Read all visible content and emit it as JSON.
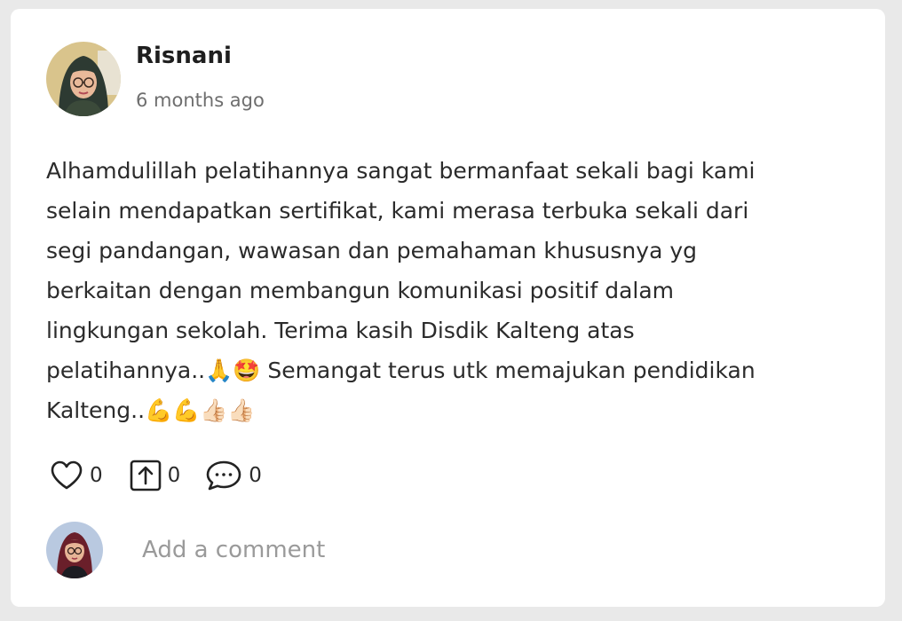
{
  "post": {
    "author": "Risnani",
    "timestamp": "6 months ago",
    "body_lines": [
      "Alhamdulillah pelatihannya sangat bermanfaat sekali bagi kami",
      "selain mendapatkan sertifikat, kami merasa terbuka sekali dari",
      "segi pandangan, wawasan dan pemahaman khususnya yg",
      "berkaitan dengan membangun komunikasi positif dalam",
      "lingkungan sekolah. Terima kasih Disdik Kalteng atas",
      "pelatihannya..🙏🤩 Semangat terus utk memajukan pendidikan",
      "Kalteng..💪💪👍🏻👍🏻"
    ]
  },
  "actions": {
    "likes": "0",
    "shares": "0",
    "comments": "0"
  },
  "comment_box": {
    "placeholder": "Add a comment"
  },
  "icons": {
    "like": "heart-icon",
    "share": "share-up-arrow-icon",
    "comment": "speech-bubble-icon"
  },
  "colors": {
    "background": "#e9e9e9",
    "card": "#ffffff",
    "text": "#2b2b2b",
    "muted": "#6e6e6e"
  }
}
